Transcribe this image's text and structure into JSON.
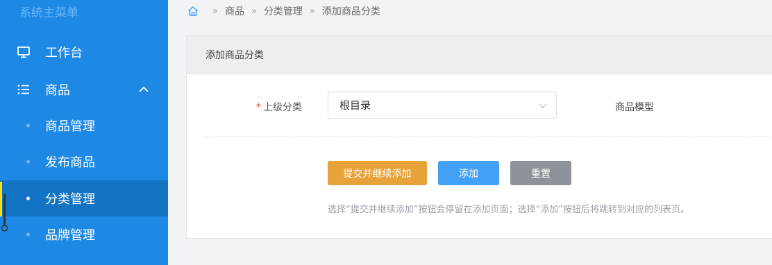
{
  "sidebar": {
    "brand": "系统主菜单",
    "items": [
      {
        "label": "工作台",
        "icon": "monitor-icon"
      },
      {
        "label": "商品",
        "icon": "list-icon",
        "expanded": true
      },
      {
        "label": "商品管理"
      },
      {
        "label": "发布商品"
      },
      {
        "label": "分类管理",
        "active": true
      },
      {
        "label": "品牌管理"
      }
    ]
  },
  "breadcrumb": {
    "items": [
      "商品",
      "分类管理",
      "添加商品分类"
    ],
    "separator": "»"
  },
  "card": {
    "title": "添加商品分类",
    "parent_label": "上级分类",
    "required_mark": "*",
    "parent_value": "根目录",
    "model_label": "商品模型",
    "buttons": {
      "submit_continue": "提交并继续添加",
      "add": "添加",
      "reset": "重置"
    },
    "hint": "选择“提交并继续添加”按钮会停留在添加页面；选择“添加”按钮后将跳转到对应的列表页。"
  },
  "colors": {
    "sidebar_bg": "#1e88e5",
    "active_item_bg": "#1373c4",
    "orange_button": "#e8a23a",
    "blue_button": "#42a0f5",
    "gray_button": "#8e9399"
  }
}
